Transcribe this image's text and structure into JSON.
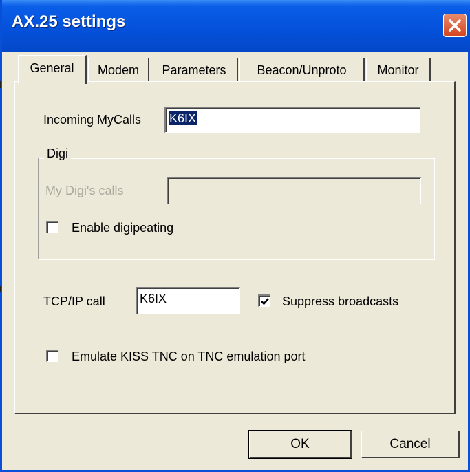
{
  "window": {
    "title": "AX.25 settings"
  },
  "tabs": [
    {
      "label": "General",
      "active": true
    },
    {
      "label": "Modem"
    },
    {
      "label": "Parameters"
    },
    {
      "label": "Beacon/Unproto"
    },
    {
      "label": "Monitor"
    }
  ],
  "general": {
    "incoming_mycalls_label": "Incoming MyCalls",
    "incoming_mycalls_value": "K6IX",
    "digi_group_label": "Digi",
    "my_digi_calls_label": "My Digi's calls",
    "my_digi_calls_value": "",
    "enable_digipeating_label": "Enable digipeating",
    "enable_digipeating_checked": false,
    "tcpip_call_label": "TCP/IP call",
    "tcpip_call_value": "K6IX",
    "suppress_broadcasts_label": "Suppress broadcasts",
    "suppress_broadcasts_checked": true,
    "emulate_kiss_label": "Emulate KISS TNC on TNC emulation port",
    "emulate_kiss_checked": false
  },
  "buttons": {
    "ok": "OK",
    "cancel": "Cancel"
  },
  "colors": {
    "titlebar": "#0450d9",
    "face": "#ece9d8",
    "selection": "#0a246a",
    "close": "#d3431f"
  }
}
